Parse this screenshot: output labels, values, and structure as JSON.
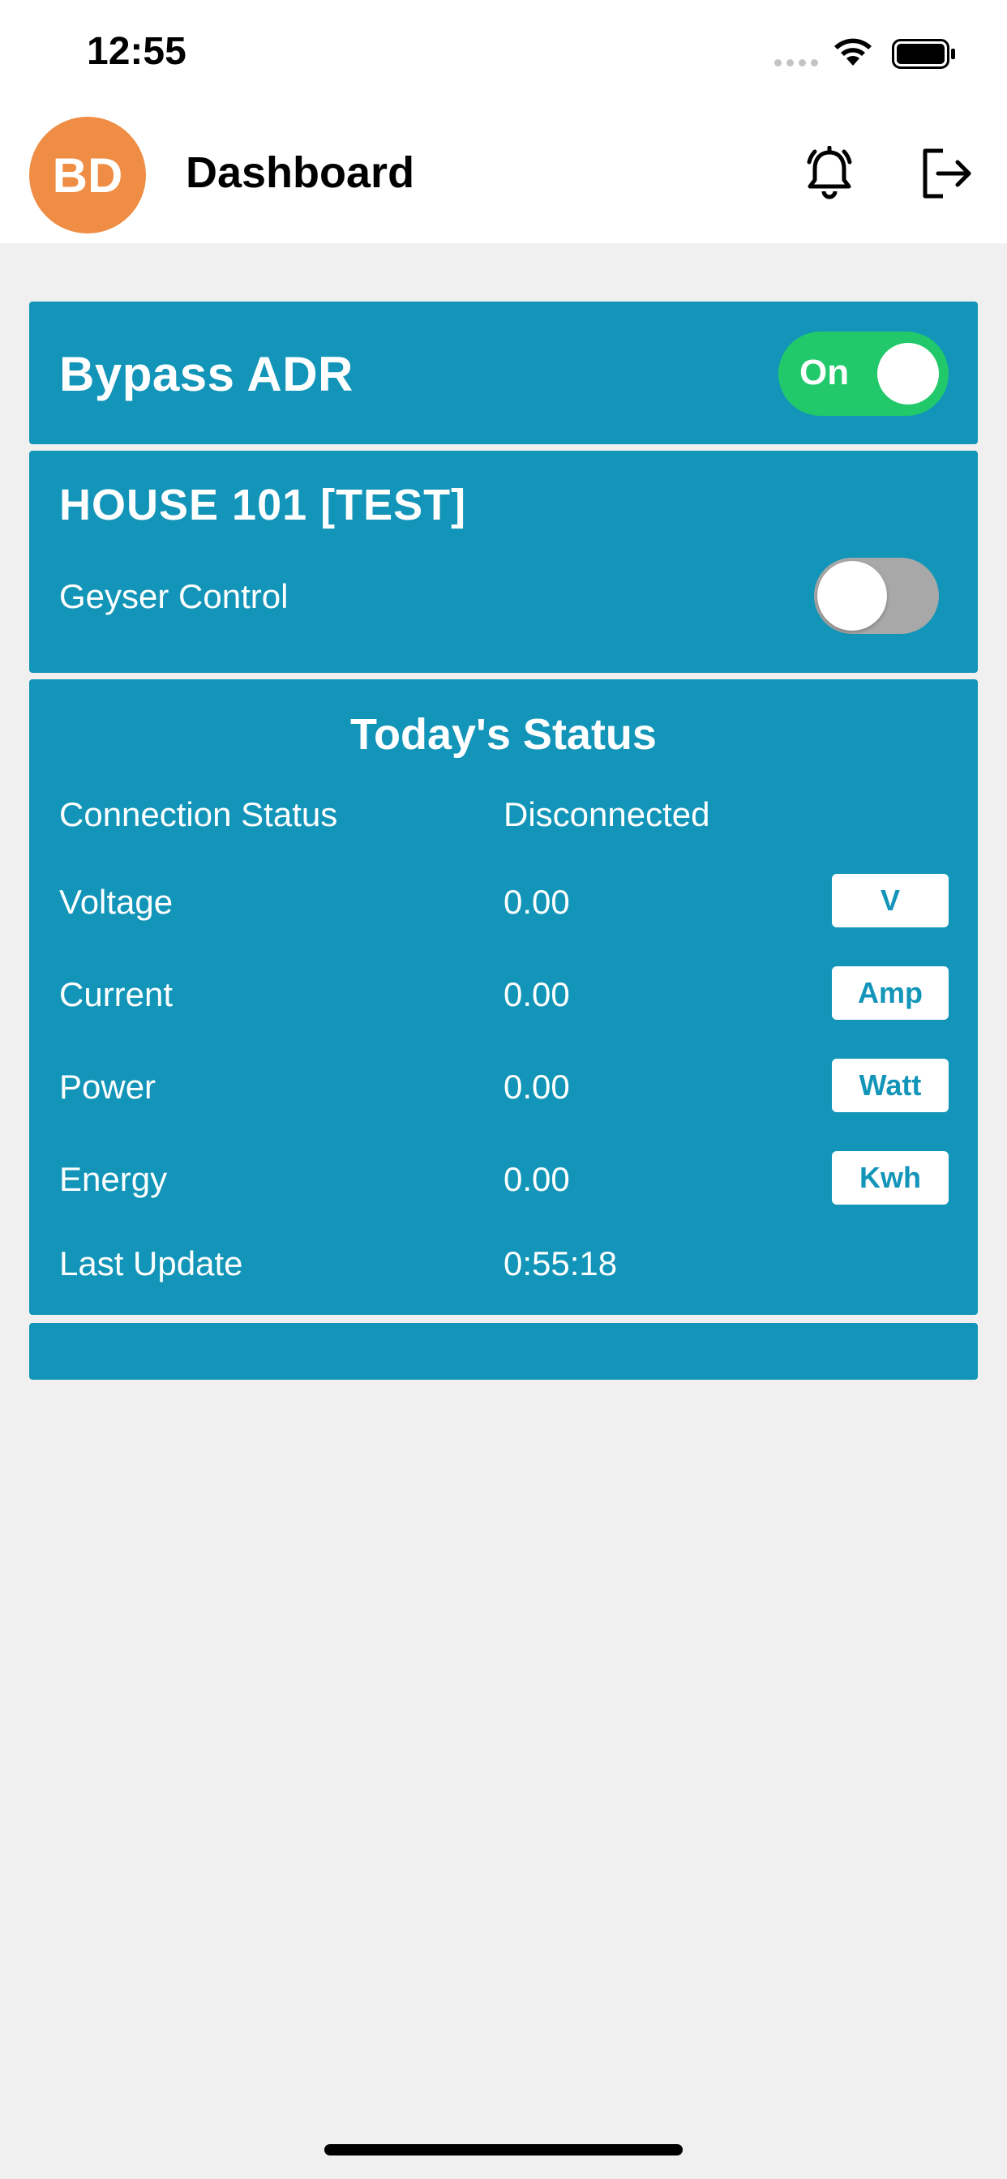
{
  "status_bar": {
    "time": "12:55",
    "icons": [
      "signal-icon",
      "wifi-icon",
      "battery-icon"
    ]
  },
  "header": {
    "avatar_initials": "BD",
    "title": "Dashboard",
    "icons": [
      "bell-icon",
      "logout-icon"
    ]
  },
  "bypass": {
    "title": "Bypass ADR",
    "toggle_label": "On",
    "toggle_state": true
  },
  "house": {
    "title": "HOUSE 101 [TEST]",
    "geyser_label": "Geyser Control",
    "geyser_state": false
  },
  "status": {
    "title": "Today's Status",
    "rows": [
      {
        "label": "Connection Status",
        "value": "Disconnected"
      },
      {
        "label": "Voltage",
        "value": "0.00",
        "unit": "V"
      },
      {
        "label": "Current",
        "value": "0.00",
        "unit": "Amp"
      },
      {
        "label": "Power",
        "value": "0.00",
        "unit": "Watt"
      },
      {
        "label": "Energy",
        "value": "0.00",
        "unit": "Kwh"
      },
      {
        "label": "Last Update",
        "value": "0:55:18"
      }
    ]
  },
  "colors": {
    "card": "#1295b8",
    "avatar": "#ef8d44",
    "toggle_on": "#21c96b",
    "toggle_off": "#a8a8a8",
    "background": "#f0f0f0"
  }
}
